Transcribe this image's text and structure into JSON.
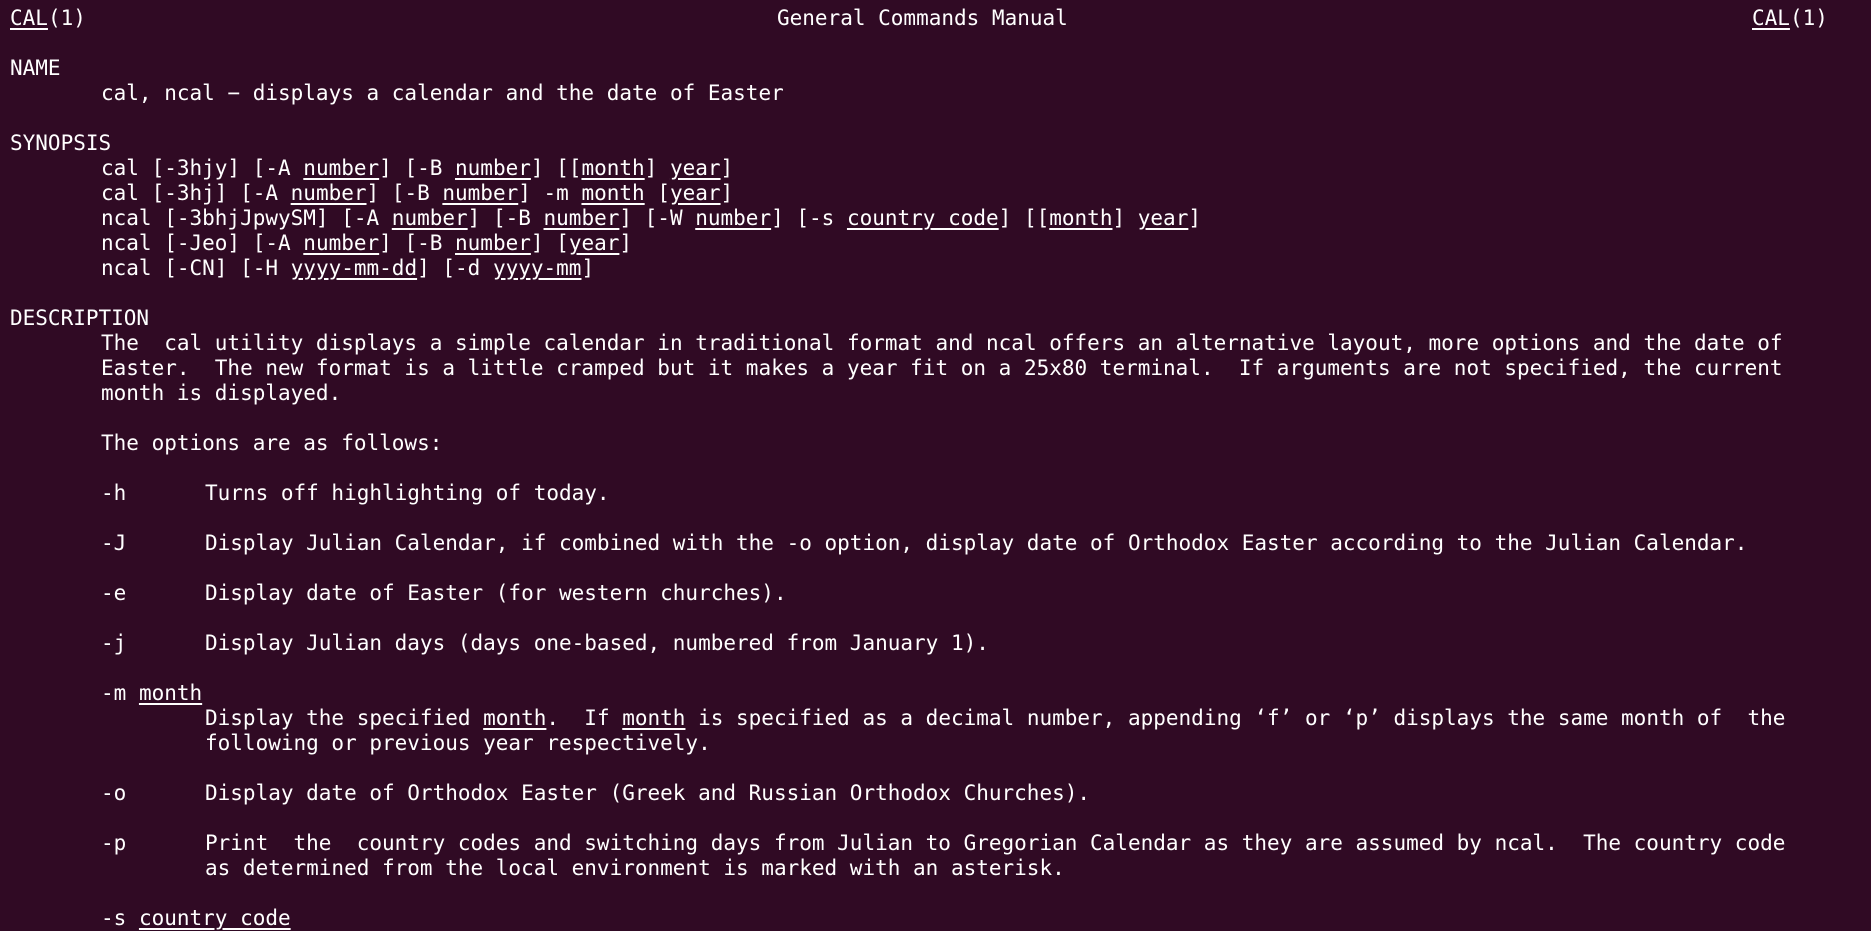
{
  "header": {
    "left_name": "CAL",
    "left_suffix": "(1)",
    "center": "General Commands Manual",
    "right_name": "CAL",
    "right_suffix": "(1)"
  },
  "sections": {
    "name_title": "NAME",
    "name_text": "cal, ncal − displays a calendar and the date of Easter",
    "synopsis_title": "SYNOPSIS",
    "description_title": "DESCRIPTION"
  },
  "synopsis": {
    "l1": {
      "a": "cal [-3hjy] [-A ",
      "b": "number",
      "c": "] [-B ",
      "d": "number",
      "e": "] [[",
      "f": "month",
      "g": "] ",
      "h": "year",
      "i": "]"
    },
    "l2": {
      "a": "cal [-3hj] [-A ",
      "b": "number",
      "c": "] [-B ",
      "d": "number",
      "e": "] -m ",
      "f": "month",
      "g": " [",
      "h": "year",
      "i": "]"
    },
    "l3": {
      "a": "ncal [-3bhjJpwySM] [-A ",
      "b": "number",
      "c": "] [-B ",
      "d": "number",
      "e": "] [-W ",
      "f": "number",
      "g": "] [-s ",
      "h": "country_code",
      "i": "] [[",
      "j": "month",
      "k": "] ",
      "l": "year",
      "m": "]"
    },
    "l4": {
      "a": "ncal [-Jeo] [-A ",
      "b": "number",
      "c": "] [-B ",
      "d": "number",
      "e": "] [",
      "f": "year",
      "g": "]"
    },
    "l5": {
      "a": "ncal [-CN] [-H ",
      "b": "yyyy-mm-dd",
      "c": "] [-d ",
      "d": "yyyy-mm",
      "e": "]"
    }
  },
  "description": {
    "p1_l1": "The  cal utility displays a simple calendar in traditional format and ncal offers an alternative layout, more options and the date of",
    "p1_l2": "Easter.  The new format is a little cramped but it makes a year fit on a 25x80 terminal.  If arguments are not specified, the current",
    "p1_l3": "month is displayed.",
    "p2": "The options are as follows:"
  },
  "options": {
    "h_flag": "-h",
    "h_text": "Turns off highlighting of today.",
    "J_flag": "-J",
    "J_text": "Display Julian Calendar, if combined with the -o option, display date of Orthodox Easter according to the Julian Calendar.",
    "e_flag": "-e",
    "e_text": "Display date of Easter (for western churches).",
    "j_flag": "-j",
    "j_text": "Display Julian days (days one-based, numbered from January 1).",
    "m_flag": "-m ",
    "m_arg": "month",
    "m_l1a": "Display the specified ",
    "m_l1b": "month",
    "m_l1c": ".  If ",
    "m_l1d": "month",
    "m_l1e": " is specified as a decimal number, appending ‘f’ or ‘p’ displays the same month of  the",
    "m_l2": "following or previous year respectively.",
    "o_flag": "-o",
    "o_text": "Display date of Orthodox Easter (Greek and Russian Orthodox Churches).",
    "p_flag": "-p",
    "p_l1": "Print  the  country codes and switching days from Julian to Gregorian Calendar as they are assumed by ncal.  The country code",
    "p_l2": "as determined from the local environment is marked with an asterisk.",
    "s_flag": "-s ",
    "s_arg": "country_code"
  }
}
